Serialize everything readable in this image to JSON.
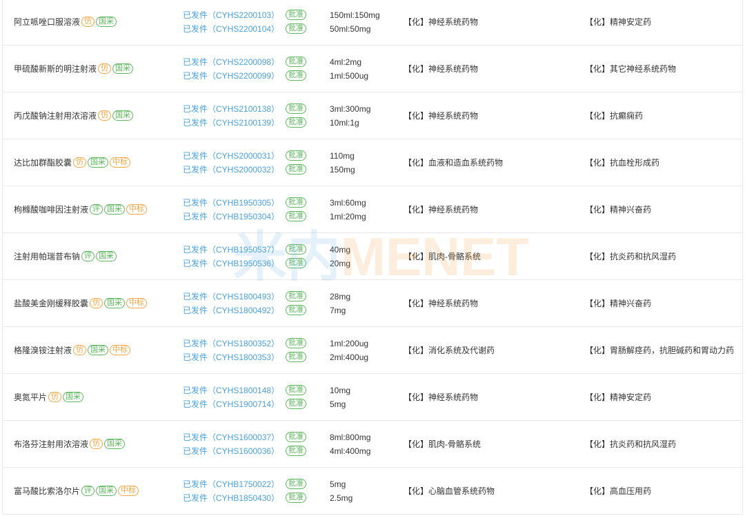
{
  "colors": {
    "text": "#333333",
    "link": "#4aa0e0",
    "orange": "#f2a541",
    "green": "#5cb85c",
    "border": "#e8e8e8"
  },
  "watermark": {
    "cn": "米内",
    "en": "MENET",
    "cn_color": "#6fb4ea",
    "en_color": "#f2a04a"
  },
  "rows": [
    {
      "name": "阿立哌唑口服溶液",
      "tags": [
        {
          "label": "仿",
          "color": "#f2a541"
        },
        {
          "label": "国采",
          "color": "#5cb85c"
        }
      ],
      "filings": [
        {
          "status": "已发件（CYHS2200103）",
          "badge": "批准"
        },
        {
          "status": "已发件（CYHS2200104）",
          "badge": "批准"
        }
      ],
      "specs": [
        "150ml:150mg",
        "50ml:50mg"
      ],
      "category": "【化】神经系统药物",
      "subcategory": "【化】精神安定药"
    },
    {
      "name": "甲硫酸新斯的明注射液",
      "tags": [
        {
          "label": "仿",
          "color": "#f2a541"
        },
        {
          "label": "国采",
          "color": "#5cb85c"
        }
      ],
      "filings": [
        {
          "status": "已发件（CYHS2200098）",
          "badge": "批准"
        },
        {
          "status": "已发件（CYHS2200099）",
          "badge": "批准"
        }
      ],
      "specs": [
        "4ml:2mg",
        "1ml:500ug"
      ],
      "category": "【化】神经系统药物",
      "subcategory": "【化】其它神经系统药物"
    },
    {
      "name": "丙戊酸钠注射用浓溶液",
      "tags": [
        {
          "label": "仿",
          "color": "#f2a541"
        },
        {
          "label": "国采",
          "color": "#5cb85c"
        }
      ],
      "filings": [
        {
          "status": "已发件（CYHS2100138）",
          "badge": "批准"
        },
        {
          "status": "已发件（CYHS2100139）",
          "badge": "批准"
        }
      ],
      "specs": [
        "3ml:300mg",
        "10ml:1g"
      ],
      "category": "【化】神经系统药物",
      "subcategory": "【化】抗癫痫药"
    },
    {
      "name": "达比加群酯胶囊",
      "tags": [
        {
          "label": "仿",
          "color": "#f2a541"
        },
        {
          "label": "国采",
          "color": "#5cb85c"
        },
        {
          "label": "中标",
          "color": "#f2a541"
        }
      ],
      "filings": [
        {
          "status": "已发件（CYHS2000031）",
          "badge": "批准"
        },
        {
          "status": "已发件（CYHS2000032）",
          "badge": "批准"
        }
      ],
      "specs": [
        "110mg",
        "150mg"
      ],
      "category": "【化】血液和造血系统药物",
      "subcategory": "【化】抗血栓形成药"
    },
    {
      "name": "枸橼酸咖啡因注射液",
      "tags": [
        {
          "label": "评",
          "color": "#5cb85c"
        },
        {
          "label": "国采",
          "color": "#5cb85c"
        },
        {
          "label": "中标",
          "color": "#f2a541"
        }
      ],
      "filings": [
        {
          "status": "已发件（CYHB1950305）",
          "badge": "批准"
        },
        {
          "status": "已发件（CYHB1950304）",
          "badge": "批准"
        }
      ],
      "specs": [
        "3ml:60mg",
        "1ml:20mg"
      ],
      "category": "【化】神经系统药物",
      "subcategory": "【化】精神兴奋药"
    },
    {
      "name": "注射用帕瑞昔布钠",
      "tags": [
        {
          "label": "评",
          "color": "#5cb85c"
        },
        {
          "label": "国采",
          "color": "#5cb85c"
        }
      ],
      "filings": [
        {
          "status": "已发件（CYHB1950537）",
          "badge": "批准"
        },
        {
          "status": "已发件（CYHB1950536）",
          "badge": "批准"
        }
      ],
      "specs": [
        "40mg",
        "20mg"
      ],
      "category": "【化】肌肉-骨骼系统",
      "subcategory": "【化】抗炎药和抗风湿药"
    },
    {
      "name": "盐酸美金刚缓释胶囊",
      "tags": [
        {
          "label": "仿",
          "color": "#f2a541"
        },
        {
          "label": "国采",
          "color": "#5cb85c"
        },
        {
          "label": "中标",
          "color": "#f2a541"
        }
      ],
      "filings": [
        {
          "status": "已发件（CYHS1800493）",
          "badge": "批准"
        },
        {
          "status": "已发件（CYHS1800492）",
          "badge": "批准"
        }
      ],
      "specs": [
        "28mg",
        "7mg"
      ],
      "category": "【化】神经系统药物",
      "subcategory": "【化】精神兴奋药"
    },
    {
      "name": "格隆溴铵注射液",
      "tags": [
        {
          "label": "仿",
          "color": "#f2a541"
        },
        {
          "label": "国采",
          "color": "#5cb85c"
        },
        {
          "label": "中标",
          "color": "#f2a541"
        }
      ],
      "filings": [
        {
          "status": "已发件（CYHS1800352）",
          "badge": "批准"
        },
        {
          "status": "已发件（CYHS1800353）",
          "badge": "批准"
        }
      ],
      "specs": [
        "1ml:200ug",
        "2ml:400ug"
      ],
      "category": "【化】消化系统及代谢药",
      "subcategory": "【化】胃肠解痉药，抗胆碱药和胃动力药"
    },
    {
      "name": "奥氮平片",
      "tags": [
        {
          "label": "仿",
          "color": "#f2a541"
        },
        {
          "label": "国采",
          "color": "#5cb85c"
        }
      ],
      "filings": [
        {
          "status": "已发件（CYHS1800148）",
          "badge": "批准"
        },
        {
          "status": "已发件（CYHS1900714）",
          "badge": "批准"
        }
      ],
      "specs": [
        "10mg",
        "5mg"
      ],
      "category": "【化】神经系统药物",
      "subcategory": "【化】精神安定药"
    },
    {
      "name": "布洛芬注射用浓溶液",
      "tags": [
        {
          "label": "仿",
          "color": "#f2a541"
        },
        {
          "label": "国采",
          "color": "#5cb85c"
        }
      ],
      "filings": [
        {
          "status": "已发件（CYHS1600037）",
          "badge": "批准"
        },
        {
          "status": "已发件（CYHS1600036）",
          "badge": "批准"
        }
      ],
      "specs": [
        "8ml:800mg",
        "4ml:400mg"
      ],
      "category": "【化】肌肉-骨骼系统",
      "subcategory": "【化】抗炎药和抗风湿药"
    },
    {
      "name": "富马酸比索洛尔片",
      "tags": [
        {
          "label": "评",
          "color": "#5cb85c"
        },
        {
          "label": "国采",
          "color": "#5cb85c"
        },
        {
          "label": "中标",
          "color": "#f2a541"
        }
      ],
      "filings": [
        {
          "status": "已发件（CYHB1750022）",
          "badge": "批准"
        },
        {
          "status": "已发件（CYHB1850430）",
          "badge": "批准"
        }
      ],
      "specs": [
        "5mg",
        "2.5mg"
      ],
      "category": "【化】心脑血管系统药物",
      "subcategory": "【化】高血压用药"
    }
  ]
}
